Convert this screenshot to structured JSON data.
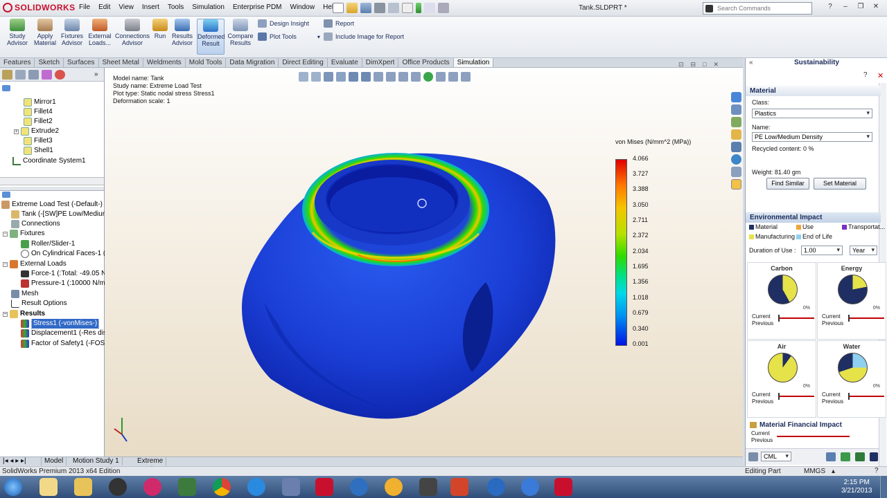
{
  "titlebar": {
    "app_name": "SOLIDWORKS",
    "menus": [
      "File",
      "Edit",
      "View",
      "Insert",
      "Tools",
      "Simulation",
      "Enterprise PDM",
      "Window",
      "Help"
    ],
    "document_title": "Tank.SLDPRT *",
    "search_placeholder": "Search Commands"
  },
  "ribbon": {
    "study_advisor": "Study Advisor",
    "apply_material": "Apply Material",
    "fixtures_advisor": "Fixtures Advisor",
    "external_loads": "External Loads...",
    "connections_advisor": "Connections Advisor",
    "run": "Run",
    "results_advisor": "Results Advisor",
    "deformed_result": "Deformed Result",
    "compare_results": "Compare Results",
    "design_insight": "Design Insight",
    "plot_tools": "Plot Tools",
    "report": "Report",
    "include_image": "Include Image for Report"
  },
  "tabs": [
    "Features",
    "Sketch",
    "Surfaces",
    "Sheet Metal",
    "Weldments",
    "Mold Tools",
    "Data Migration",
    "Direct Editing",
    "Evaluate",
    "DimXpert",
    "Office Products",
    "Simulation"
  ],
  "feature_tree": [
    "Mirror1",
    "Fillet4",
    "Fillet2",
    "Extrude2",
    "Fillet3",
    "Shell1",
    "Coordinate System1"
  ],
  "sim_tree": {
    "study": "Extreme Load Test (-Default-)",
    "part": "Tank (-[SW]PE Low/Medium",
    "connections": "Connections",
    "fixtures": "Fixtures",
    "fixture1": "Roller/Slider-1",
    "fixture2": "On Cylindrical Faces-1 (:",
    "external_loads": "External Loads",
    "force": "Force-1 (:Total: -49.05 N",
    "pressure": "Pressure-1 (:10000 N/m^",
    "mesh": "Mesh",
    "result_options": "Result Options",
    "results": "Results",
    "stress": "Stress1 (-vonMises-)",
    "displacement": "Displacement1 (-Res disp",
    "fos": "Factor of Safety1 (-FOS-"
  },
  "plot_info": {
    "model": "Model name: Tank",
    "study": "Study name: Extreme Load Test",
    "type": "Plot type: Static nodal stress Stress1",
    "scale": "Deformation scale: 1"
  },
  "legend": {
    "title": "von Mises (N/mm^2 (MPa))",
    "values": [
      "4.066",
      "3.727",
      "3.388",
      "3.050",
      "2.711",
      "2.372",
      "2.034",
      "1.695",
      "1.356",
      "1.018",
      "0.679",
      "0.340",
      "0.001"
    ]
  },
  "sustainability": {
    "panel_title": "Sustainability",
    "material_header": "Material",
    "class_label": "Class:",
    "class_value": "Plastics",
    "name_label": "Name:",
    "name_value": "PE Low/Medium Density",
    "recycled": "Recycled content: 0 %",
    "weight": "Weight: 81.40 gm",
    "find_similar": "Find Similar",
    "set_material": "Set Material",
    "env_header": "Environmental Impact",
    "legend_items": [
      "Material",
      "Use",
      "Transportat...",
      "Manufacturing",
      "End of Life"
    ],
    "duration_label": "Duration of Use :",
    "duration_value": "1.00",
    "duration_unit": "Year",
    "cards": [
      {
        "title": "Carbon",
        "pct": "0%",
        "current": "Current",
        "previous": "Previous"
      },
      {
        "title": "Energy",
        "pct": "0%",
        "current": "Current",
        "previous": "Previous"
      },
      {
        "title": "Air",
        "pct": "0%",
        "current": "Current",
        "previous": "Previous"
      },
      {
        "title": "Water",
        "pct": "0%",
        "current": "Current",
        "previous": "Previous"
      }
    ],
    "financial_header": "Material Financial Impact",
    "fin_current": "Current",
    "fin_previous": "Previous",
    "unit_select": "CML"
  },
  "bottom_tabs": [
    "Model",
    "Motion Study 1",
    "Extreme Load Test"
  ],
  "status": {
    "left": "SolidWorks Premium 2013 x64 Edition",
    "mode": "Editing Part",
    "units": "MMGS"
  },
  "clock": {
    "time": "2:15 PM",
    "date": "3/21/2013"
  },
  "colors": {
    "accent": "#1c4f9c",
    "sim_blue": "#1d3fd0",
    "legend_top": "#e00000",
    "legend_bottom": "#0014e6"
  }
}
